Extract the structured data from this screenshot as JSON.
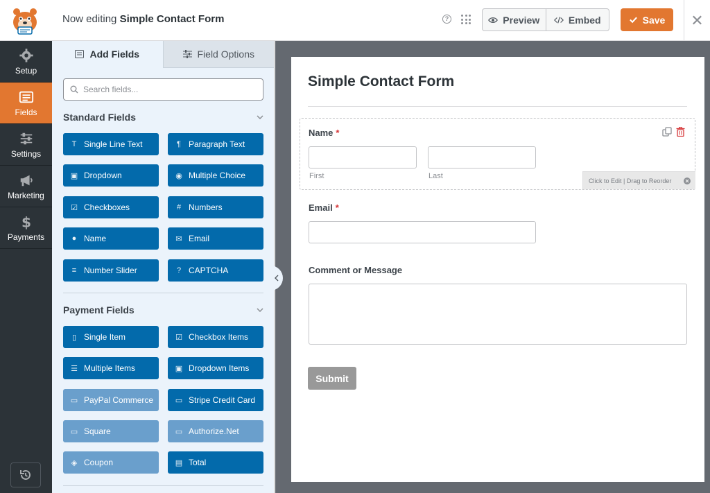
{
  "header": {
    "editing_prefix": "Now editing",
    "form_name": "Simple Contact Form",
    "preview_label": "Preview",
    "embed_label": "Embed",
    "save_label": "Save"
  },
  "nav": {
    "items": [
      {
        "label": "Setup",
        "icon": "gear-icon"
      },
      {
        "label": "Fields",
        "icon": "fields-icon",
        "active": true
      },
      {
        "label": "Settings",
        "icon": "sliders-icon"
      },
      {
        "label": "Marketing",
        "icon": "megaphone-icon"
      },
      {
        "label": "Payments",
        "icon": "dollar-icon"
      }
    ]
  },
  "panel": {
    "tabs": [
      "Add Fields",
      "Field Options"
    ],
    "search_placeholder": "Search fields...",
    "standard_title": "Standard Fields",
    "standard_fields": [
      "Single Line Text",
      "Paragraph Text",
      "Dropdown",
      "Multiple Choice",
      "Checkboxes",
      "Numbers",
      "Name",
      "Email",
      "Number Slider",
      "CAPTCHA"
    ],
    "payment_title": "Payment Fields",
    "payment_fields": [
      "Single Item",
      "Checkbox Items",
      "Multiple Items",
      "Dropdown Items",
      "PayPal Commerce",
      "Stripe Credit Card",
      "Square",
      "Authorize.Net",
      "Coupon",
      "Total"
    ]
  },
  "form": {
    "title": "Simple Contact Form",
    "name_label": "Name",
    "required_mark": "*",
    "first_sublabel": "First",
    "last_sublabel": "Last",
    "edit_hint": "Click to Edit | Drag to Reorder",
    "email_label": "Email",
    "comment_label": "Comment or Message",
    "submit_label": "Submit"
  },
  "colors": {
    "accent": "#e27730",
    "field_button": "#036aab",
    "nav_bg": "#2c3338"
  }
}
